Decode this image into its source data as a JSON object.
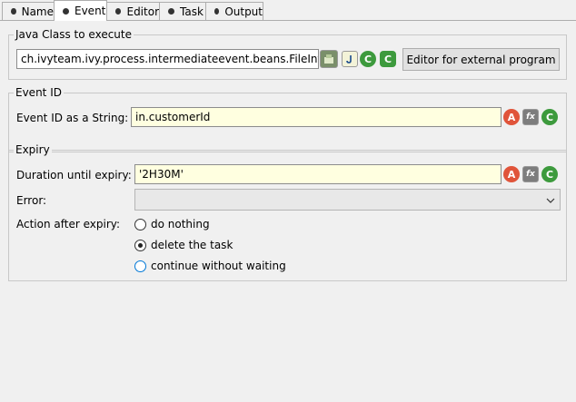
{
  "tabs": [
    {
      "label": "Name"
    },
    {
      "label": "Event"
    },
    {
      "label": "Editor"
    },
    {
      "label": "Task"
    },
    {
      "label": "Output"
    }
  ],
  "java_class": {
    "title": "Java Class to execute",
    "value": "ch.ivyteam.ivy.process.intermediateevent.beans.FileInterf",
    "editor_button": "Editor for external program"
  },
  "event_id": {
    "title": "Event ID",
    "label": "Event ID as a String:",
    "value": "in.customerId"
  },
  "expiry": {
    "title": "Expiry",
    "duration_label": "Duration until expiry:",
    "duration_value": "'2H30M'",
    "error_label": "Error:",
    "error_value": "",
    "action_label": "Action after expiry:",
    "options": [
      {
        "label": "do nothing"
      },
      {
        "label": "delete the task"
      },
      {
        "label": "continue without waiting"
      }
    ],
    "selected_option": "delete the task"
  },
  "colors": {
    "attribute_button": "#e0543a",
    "function_button": "#7d7d7d",
    "green_button": "#3d9a3d",
    "field_highlight": "#ffffe0"
  }
}
